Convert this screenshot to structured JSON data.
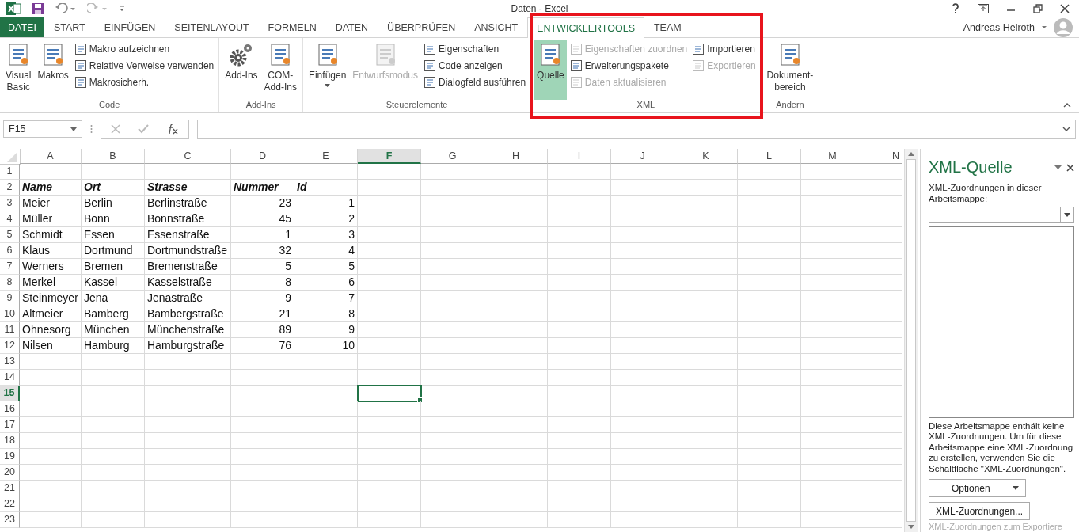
{
  "window": {
    "title": "Daten - Excel",
    "user": "Andreas Heiroth"
  },
  "tabs": [
    {
      "label": "DATEI",
      "kind": "file",
      "selected": false
    },
    {
      "label": "START",
      "kind": "tab",
      "selected": false
    },
    {
      "label": "EINFÜGEN",
      "kind": "tab",
      "selected": false
    },
    {
      "label": "SEITENLAYOUT",
      "kind": "tab",
      "selected": false
    },
    {
      "label": "FORMELN",
      "kind": "tab",
      "selected": false
    },
    {
      "label": "DATEN",
      "kind": "tab",
      "selected": false
    },
    {
      "label": "ÜBERPRÜFEN",
      "kind": "tab",
      "selected": false
    },
    {
      "label": "ANSICHT",
      "kind": "tab",
      "selected": false
    },
    {
      "label": "ENTWICKLERTOOLS",
      "kind": "tab",
      "selected": true
    },
    {
      "label": "TEAM",
      "kind": "tab",
      "selected": false
    }
  ],
  "ribbon": {
    "groups": [
      {
        "label": "Code",
        "items": [
          {
            "kind": "large",
            "label": "Visual\nBasic",
            "disabled": false,
            "selected": false
          },
          {
            "kind": "large",
            "label": "Makros",
            "disabled": false,
            "selected": false
          },
          {
            "kind": "stack",
            "items": [
              {
                "label": "Makro aufzeichnen",
                "disabled": false
              },
              {
                "label": "Relative Verweise verwenden",
                "disabled": false
              },
              {
                "label": "Makrosicherh.",
                "disabled": false
              }
            ]
          }
        ]
      },
      {
        "label": "Add-Ins",
        "items": [
          {
            "kind": "large",
            "label": "Add-Ins",
            "disabled": false,
            "selected": false
          },
          {
            "kind": "large",
            "label": "COM-\nAdd-Ins",
            "disabled": false,
            "selected": false
          }
        ]
      },
      {
        "label": "Steuerelemente",
        "items": [
          {
            "kind": "large",
            "label": "Einfügen",
            "disabled": false,
            "selected": false,
            "menu": true
          },
          {
            "kind": "large",
            "label": "Entwurfsmodus",
            "disabled": true,
            "selected": false
          },
          {
            "kind": "stack",
            "items": [
              {
                "label": "Eigenschaften",
                "disabled": false
              },
              {
                "label": "Code anzeigen",
                "disabled": false
              },
              {
                "label": "Dialogfeld ausführen",
                "disabled": false
              }
            ]
          }
        ]
      },
      {
        "label": "XML",
        "items": [
          {
            "kind": "large",
            "label": "Quelle",
            "disabled": false,
            "selected": true
          },
          {
            "kind": "stack",
            "items": [
              {
                "label": "Eigenschaften zuordnen",
                "disabled": true
              },
              {
                "label": "Erweiterungspakete",
                "disabled": false
              },
              {
                "label": "Daten aktualisieren",
                "disabled": true
              }
            ]
          },
          {
            "kind": "stack",
            "items": [
              {
                "label": "Importieren",
                "disabled": false
              },
              {
                "label": "Exportieren",
                "disabled": true
              }
            ]
          }
        ]
      },
      {
        "label": "Ändern",
        "items": [
          {
            "kind": "large",
            "label": "Dokument-\nbereich",
            "disabled": false,
            "selected": false
          }
        ]
      }
    ]
  },
  "formula_bar": {
    "name_box": "F15"
  },
  "sheet": {
    "columns": [
      {
        "label": "A",
        "selected": false,
        "kind": "text"
      },
      {
        "label": "B",
        "selected": false,
        "kind": "text"
      },
      {
        "label": "C",
        "selected": false,
        "kind": "text"
      },
      {
        "label": "D",
        "selected": false,
        "kind": "number"
      },
      {
        "label": "E",
        "selected": false,
        "kind": "number"
      },
      {
        "label": "F",
        "selected": true,
        "kind": "text"
      },
      {
        "label": "G",
        "selected": false,
        "kind": "text"
      },
      {
        "label": "H",
        "selected": false,
        "kind": "text"
      },
      {
        "label": "I",
        "selected": false,
        "kind": "text"
      },
      {
        "label": "J",
        "selected": false,
        "kind": "text"
      },
      {
        "label": "K",
        "selected": false,
        "kind": "text"
      },
      {
        "label": "L",
        "selected": false,
        "kind": "text"
      },
      {
        "label": "M",
        "selected": false,
        "kind": "text"
      },
      {
        "label": "N",
        "selected": false,
        "kind": "text"
      }
    ],
    "rows": [
      {
        "number": "1",
        "kind": "data",
        "selected": false,
        "cells": []
      },
      {
        "number": "2",
        "kind": "header",
        "selected": false,
        "cells": [
          "Name",
          "Ort",
          "Strasse",
          "Nummer",
          "Id"
        ]
      },
      {
        "number": "3",
        "kind": "data",
        "selected": false,
        "cells": [
          "Meier",
          "Berlin",
          "Berlinstraße",
          "23",
          "1"
        ]
      },
      {
        "number": "4",
        "kind": "data",
        "selected": false,
        "cells": [
          "Müller",
          "Bonn",
          "Bonnstraße",
          "45",
          "2"
        ]
      },
      {
        "number": "5",
        "kind": "data",
        "selected": false,
        "cells": [
          "Schmidt",
          "Essen",
          "Essenstraße",
          "1",
          "3"
        ]
      },
      {
        "number": "6",
        "kind": "data",
        "selected": false,
        "cells": [
          "Klaus",
          "Dortmund",
          "Dortmundstraße",
          "32",
          "4"
        ]
      },
      {
        "number": "7",
        "kind": "data",
        "selected": false,
        "cells": [
          "Werners",
          "Bremen",
          "Bremenstraße",
          "5",
          "5"
        ]
      },
      {
        "number": "8",
        "kind": "data",
        "selected": false,
        "cells": [
          "Merkel",
          "Kassel",
          "Kasselstraße",
          "8",
          "6"
        ]
      },
      {
        "number": "9",
        "kind": "data",
        "selected": false,
        "cells": [
          "Steinmeyer",
          "Jena",
          "Jenastraße",
          "9",
          "7"
        ]
      },
      {
        "number": "10",
        "kind": "data",
        "selected": false,
        "cells": [
          "Altmeier",
          "Bamberg",
          "Bambergstraße",
          "21",
          "8"
        ]
      },
      {
        "number": "11",
        "kind": "data",
        "selected": false,
        "cells": [
          "Ohnesorg",
          "München",
          "Münchenstraße",
          "89",
          "9"
        ]
      },
      {
        "number": "12",
        "kind": "data",
        "selected": false,
        "cells": [
          "Nilsen",
          "Hamburg",
          "Hamburgstraße",
          "76",
          "10"
        ]
      },
      {
        "number": "13",
        "kind": "data",
        "selected": false,
        "cells": []
      },
      {
        "number": "14",
        "kind": "data",
        "selected": false,
        "cells": []
      },
      {
        "number": "15",
        "kind": "data",
        "selected": true,
        "cells": []
      },
      {
        "number": "16",
        "kind": "data",
        "selected": false,
        "cells": []
      },
      {
        "number": "17",
        "kind": "data",
        "selected": false,
        "cells": []
      },
      {
        "number": "18",
        "kind": "data",
        "selected": false,
        "cells": []
      },
      {
        "number": "19",
        "kind": "data",
        "selected": false,
        "cells": []
      },
      {
        "number": "20",
        "kind": "data",
        "selected": false,
        "cells": []
      },
      {
        "number": "21",
        "kind": "data",
        "selected": false,
        "cells": []
      },
      {
        "number": "22",
        "kind": "data",
        "selected": false,
        "cells": []
      },
      {
        "number": "23",
        "kind": "data",
        "selected": false,
        "cells": []
      }
    ]
  },
  "task_pane": {
    "title": "XML-Quelle",
    "maps_label": "XML-Zuordnungen in dieser Arbeitsmappe:",
    "message": "Diese Arbeitsmappe enthält keine XML-Zuordnungen. Um für diese Arbeitsmappe eine XML-Zuordnung zu erstellen, verwenden Sie die Schaltfläche \"XML-Zuordnungen\".",
    "buttons": [
      {
        "label": "Optionen",
        "kind": "dropdown"
      },
      {
        "label": "XML-Zuordnungen...",
        "kind": "plain"
      }
    ],
    "footer": "XML-Zuordnungen zum Exportiere"
  }
}
